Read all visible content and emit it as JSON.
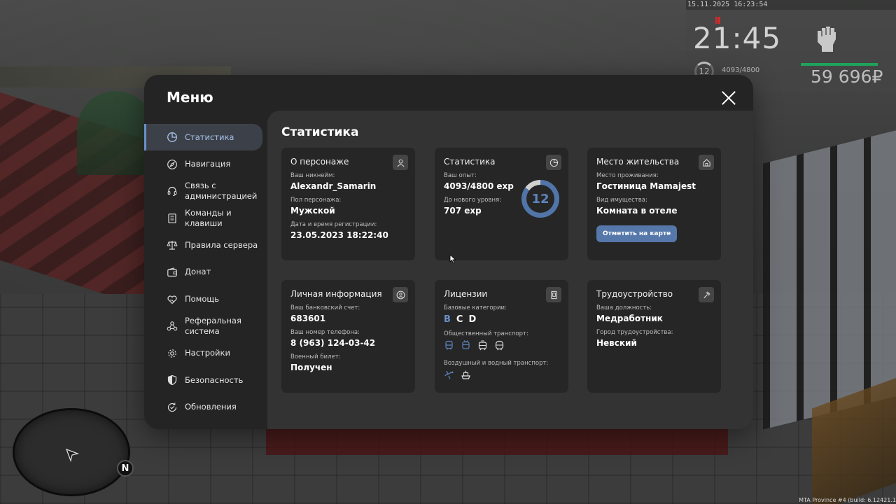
{
  "hud": {
    "datetime": "15.11.2025 16:23:54",
    "clock": "21:45",
    "level": "12",
    "exp": "4093/4800",
    "money": "59 696₽"
  },
  "minimap": {
    "north_label": "N"
  },
  "build_info": "MTA Province #4 (build: 6.12421.1",
  "menu": {
    "title": "Меню",
    "sidebar": [
      {
        "label": "Статистика",
        "icon": "pie-chart-icon",
        "active": true
      },
      {
        "label": "Навигация",
        "icon": "compass-icon"
      },
      {
        "label": "Связь с администрацией",
        "icon": "headset-icon"
      },
      {
        "label": "Команды и клавиши",
        "icon": "document-icon"
      },
      {
        "label": "Правила сервера",
        "icon": "scales-icon"
      },
      {
        "label": "Донат",
        "icon": "wallet-icon"
      },
      {
        "label": "Помощь",
        "icon": "heart-hand-icon"
      },
      {
        "label": "Реферальная система",
        "icon": "people-network-icon"
      },
      {
        "label": "Настройки",
        "icon": "gear-icon"
      },
      {
        "label": "Безопасность",
        "icon": "shield-icon"
      },
      {
        "label": "Обновления",
        "icon": "refresh-check-icon"
      }
    ]
  },
  "statistics": {
    "title": "Статистика",
    "character": {
      "title": "О персонаже",
      "nickname_label": "Ваш никнейм:",
      "nickname": "Alexandr_Samarin",
      "gender_label": "Пол персонажа:",
      "gender": "Мужской",
      "registration_label": "Дата и время регистрации:",
      "registration": "23.05.2023 18:22:40"
    },
    "stats": {
      "title": "Статистика",
      "exp_label": "Ваш опыт:",
      "exp": "4093/4800 exp",
      "next_level_label": "До нового уровня:",
      "next_level": "707 exp",
      "level": "12",
      "level_progress": 0.853
    },
    "residence": {
      "title": "Место жительства",
      "place_label": "Место проживания:",
      "place": "Гостиница Mamajest",
      "property_label": "Вид имущества:",
      "property": "Комната в отеле",
      "map_button": "Отметить на карте"
    },
    "personal": {
      "title": "Личная информация",
      "bank_label": "Ваш банковский счет:",
      "bank": "683601",
      "phone_label": "Ваш номер телефона:",
      "phone": "8 (963) 124-03-42",
      "military_label": "Военный билет:",
      "military": "Получен"
    },
    "licenses": {
      "title": "Лицензии",
      "base_label": "Базовые категории:",
      "categories": [
        "B",
        "C",
        "D"
      ],
      "public_label": "Общественный транспорт:",
      "public_icons": [
        "bus-icon",
        "trolleybus-icon",
        "tram-icon",
        "metro-icon"
      ],
      "air_water_label": "Воздушный и водный транспорт:",
      "air_water_icons": [
        "plane-icon",
        "ship-icon"
      ]
    },
    "employment": {
      "title": "Трудоустройство",
      "position_label": "Ваша должность:",
      "position": "Медработник",
      "city_label": "Город трудоустройства:",
      "city": "Невский"
    }
  }
}
